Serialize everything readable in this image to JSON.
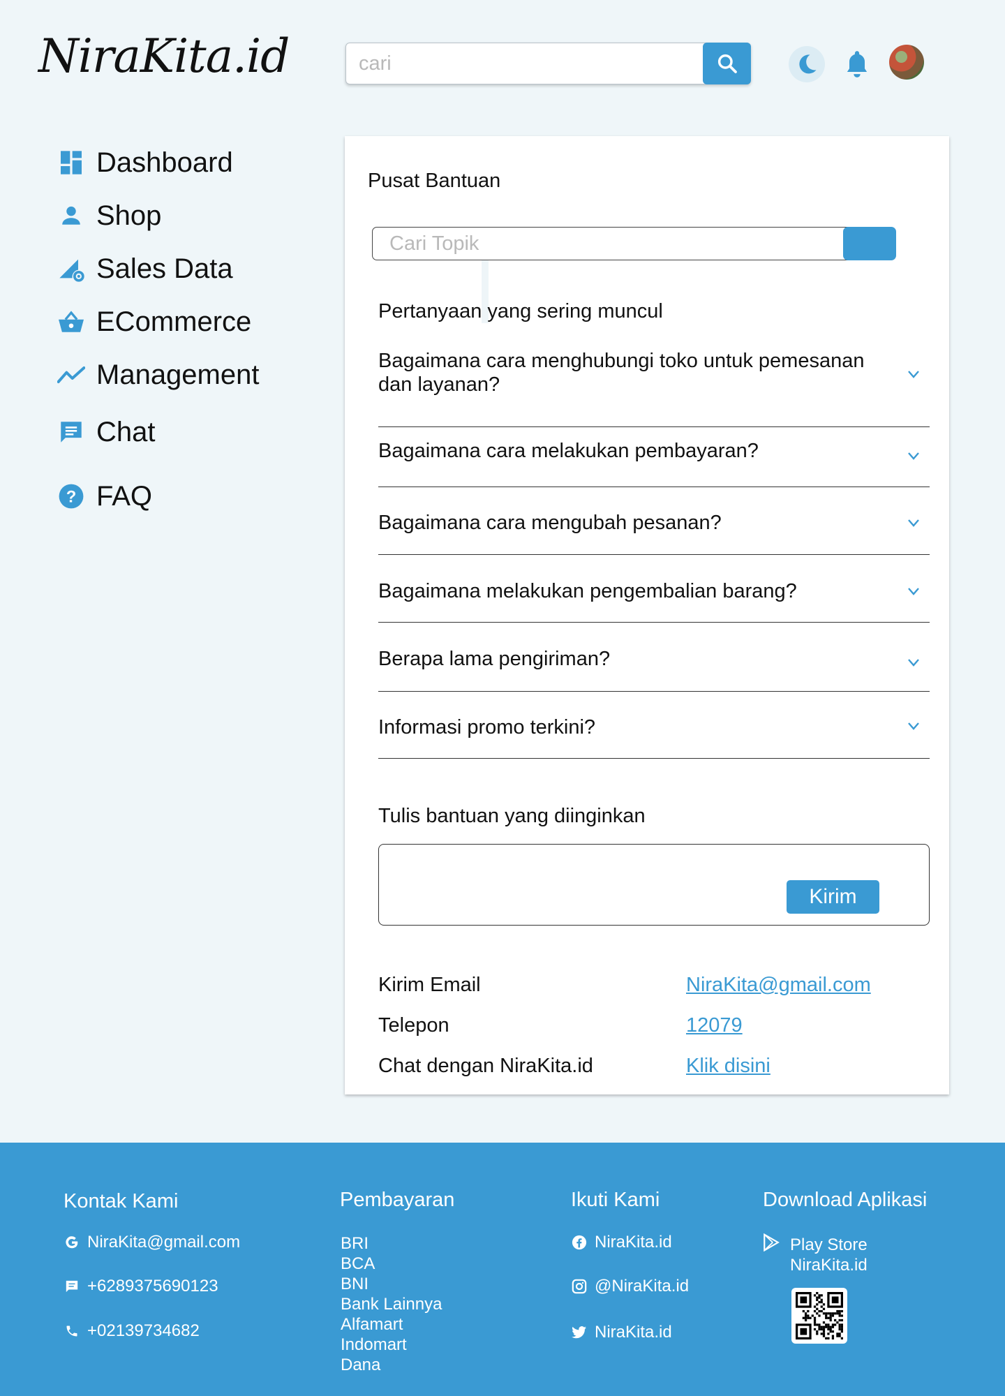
{
  "header": {
    "logo": "NiraKita.id",
    "search_placeholder": "cari",
    "icons": [
      "search-icon",
      "moon-icon",
      "bell-icon",
      "avatar"
    ]
  },
  "sidebar": {
    "items": [
      {
        "label": "Dashboard",
        "icon": "dashboard-icon"
      },
      {
        "label": "Shop",
        "icon": "person-icon"
      },
      {
        "label": "Sales Data",
        "icon": "chart-gear-icon"
      },
      {
        "label": "ECommerce",
        "icon": "basket-icon"
      },
      {
        "label": "Management",
        "icon": "trend-icon"
      },
      {
        "label": "Chat",
        "icon": "chat-icon"
      },
      {
        "label": "FAQ",
        "icon": "help-icon"
      }
    ]
  },
  "main": {
    "title": "Pusat Bantuan",
    "topic_search_placeholder": "Cari Topik",
    "faq_heading": "Pertanyaan yang sering muncul",
    "faq": [
      "Bagaimana cara menghubungi toko untuk pemesanan dan layanan?",
      "Bagaimana cara melakukan pembayaran?",
      "Bagaimana cara mengubah pesanan?",
      "Bagaimana melakukan pengembalian barang?",
      "Berapa lama pengiriman?",
      "Informasi promo terkini?"
    ],
    "help_label": "Tulis bantuan yang diinginkan",
    "send_label": "Kirim",
    "contacts": [
      {
        "label": "Kirim Email",
        "value": "NiraKita@gmail.com"
      },
      {
        "label": "Telepon",
        "value": "12079"
      },
      {
        "label": "Chat dengan NiraKita.id",
        "value": "Klik disini"
      }
    ]
  },
  "footer": {
    "contact": {
      "title": "Kontak Kami",
      "email": "NiraKita@gmail.com",
      "phone1": "+6289375690123",
      "phone2": "+02139734682"
    },
    "payment": {
      "title": "Pembayaran",
      "items": [
        "BRI",
        "BCA",
        "BNI",
        "Bank Lainnya",
        "Alfamart",
        "Indomart",
        "Dana"
      ]
    },
    "follow": {
      "title": "Ikuti Kami",
      "facebook": "NiraKita.id",
      "instagram": "@NiraKita.id",
      "twitter": "NiraKita.id"
    },
    "download": {
      "title": "Download Aplikasi",
      "store": "Play Store",
      "app": "NiraKita.id"
    }
  },
  "colors": {
    "accent": "#3a9ad3",
    "background": "#eff6f9",
    "card": "#ffffff"
  }
}
